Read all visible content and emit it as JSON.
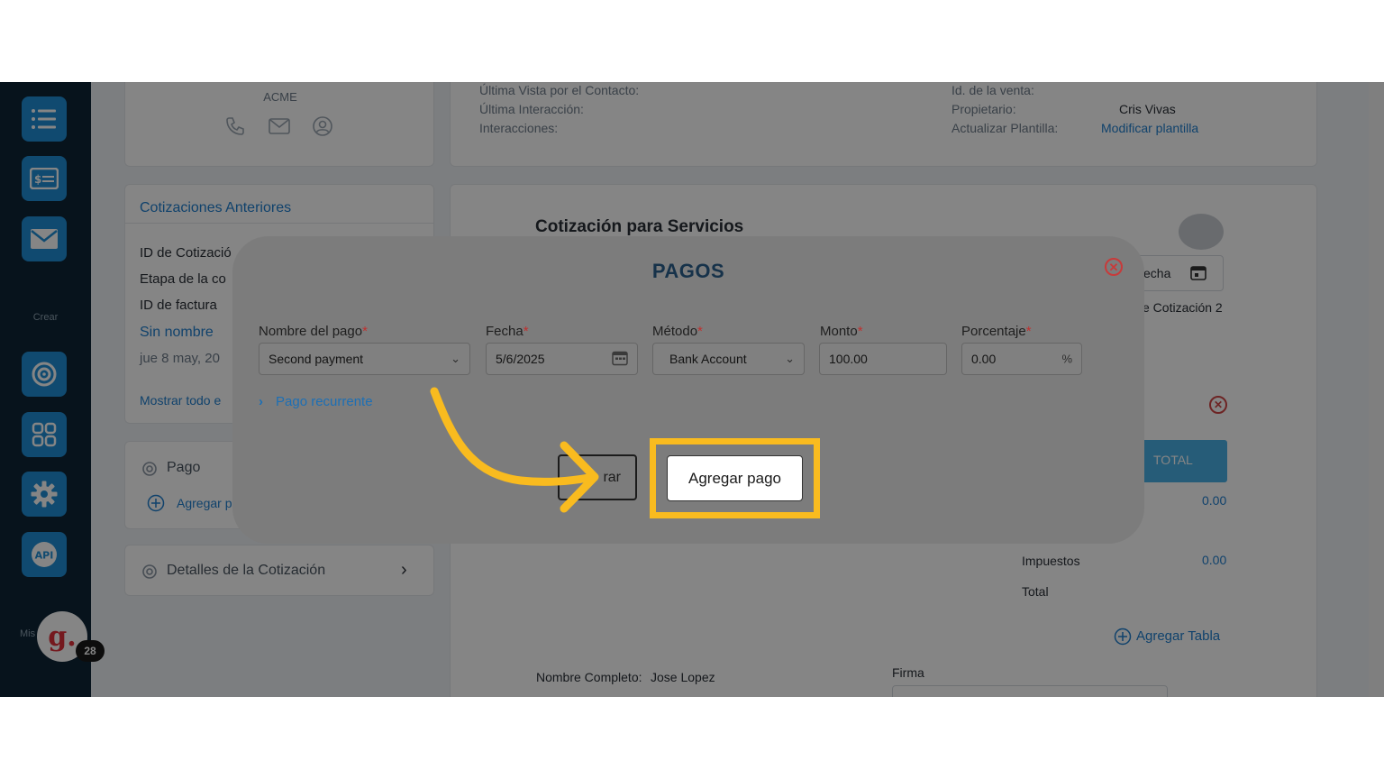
{
  "sidebar": {
    "crear_label": "Crear",
    "mis_label": "Mis",
    "avatar_letter": "g.",
    "badge_count": "28",
    "icons": [
      "list-icon",
      "invoice-icon",
      "mail-icon",
      "target-icon",
      "apps-icon",
      "gear-icon",
      "api-icon"
    ],
    "api_text": "API"
  },
  "contact_card": {
    "company": "ACME"
  },
  "info_card": {
    "last_view": "Última Vista por el Contacto:",
    "last_interaction": "Última Interacción:",
    "interactions": "Interacciones:",
    "sale_id": "Id. de la venta:",
    "owner_label": "Propietario:",
    "owner_value": "Cris Vivas",
    "template_label": "Actualizar Plantilla:",
    "template_link": "Modificar plantilla"
  },
  "previous_quotes": {
    "title": "Cotizaciones Anteriores",
    "row1": "ID de Cotizació",
    "row2": "Etapa de la co",
    "row3": "ID de factura",
    "name": "Sin nombre",
    "date": "jue 8 may, 20",
    "show_all": "Mostrar todo e"
  },
  "payment_card": {
    "title": "Pago",
    "add": "Agregar p"
  },
  "details_card": {
    "title": "Detalles de la Cotización"
  },
  "quote": {
    "title": "Cotización para Servicios",
    "date_fragment": "echa",
    "quote_fragment": "e Cotización 2",
    "total_header": "TOTAL",
    "subtotal_value": "0.00",
    "taxes_label": "Impuestos",
    "taxes_value": "0.00",
    "total_label": "Total",
    "add_table": "Agregar Tabla",
    "full_name_label": "Nombre Completo:",
    "full_name_value": "Jose Lopez",
    "signature_label": "Firma"
  },
  "modal": {
    "title": "PAGOS",
    "fields": {
      "name_label": "Nombre del pago",
      "name_value": "Second payment",
      "date_label": "Fecha",
      "date_value": "5/6/2025",
      "method_label": "Método",
      "method_value": "Bank Account",
      "amount_label": "Monto",
      "amount_value": "100.00",
      "percent_label": "Porcentaje",
      "percent_value": "0.00",
      "percent_symbol": "%"
    },
    "recurring": "Pago recurrente",
    "cancel_fragment": "rar",
    "add_button": "Agregar pago"
  },
  "colors": {
    "highlight": "#f9bb1f",
    "accent": "#1f7fd0",
    "sidebar": "#0f2536"
  }
}
